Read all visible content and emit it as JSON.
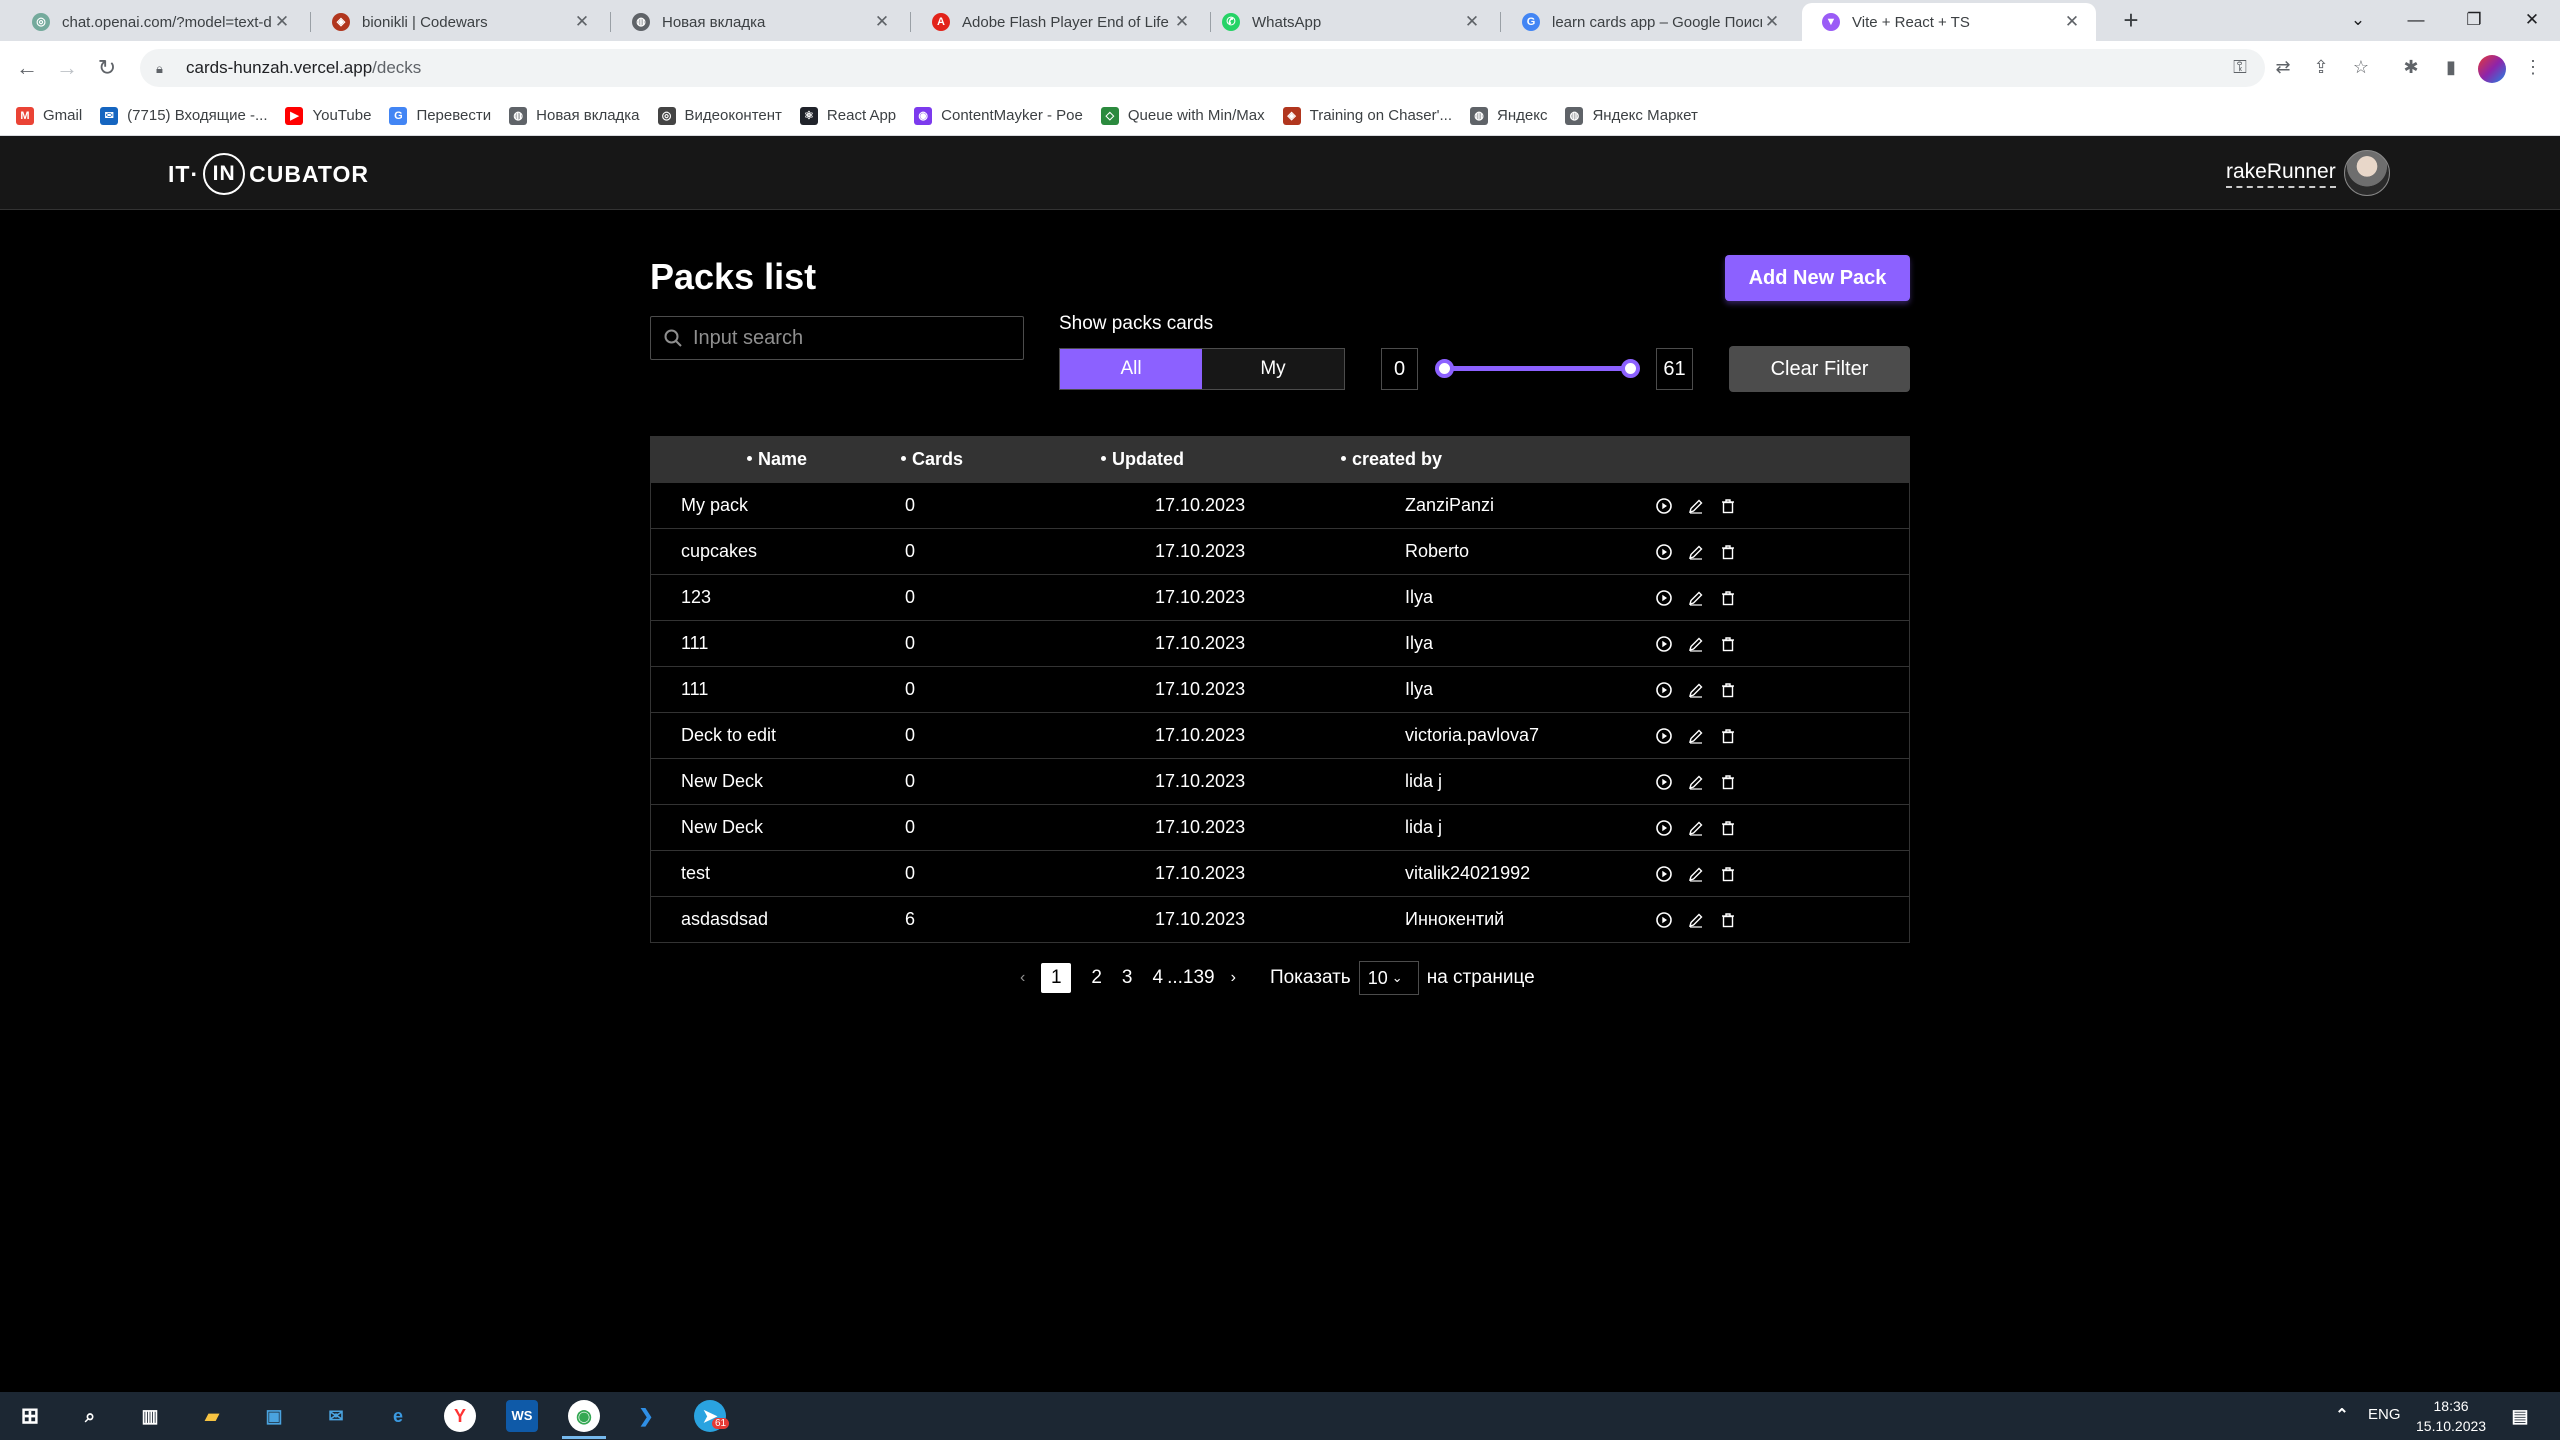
{
  "browser": {
    "tabs": [
      {
        "title": "chat.openai.com/?model=text-d",
        "color": "#74aa9c",
        "glyph": "◎"
      },
      {
        "title": "bionikli | Codewars",
        "color": "#b1361e",
        "glyph": "◈"
      },
      {
        "title": "Новая вкладка",
        "color": "#5f6368",
        "glyph": "◍"
      },
      {
        "title": "Adobe Flash Player End of Life",
        "color": "#e2231a",
        "glyph": "A"
      },
      {
        "title": "WhatsApp",
        "color": "#25d366",
        "glyph": "✆"
      },
      {
        "title": "learn cards app – Google Поиск",
        "color": "#4285f4",
        "glyph": "G"
      },
      {
        "title": "Vite + React + TS",
        "color": "#9a5cf6",
        "glyph": "▼"
      }
    ],
    "url_host": "cards-hunzah.vercel.app",
    "url_path": "/decks",
    "bookmarks": [
      {
        "label": "Gmail",
        "color": "#ea4335",
        "glyph": "M"
      },
      {
        "label": "(7715) Входящие -...",
        "color": "#1565c0",
        "glyph": "✉"
      },
      {
        "label": "YouTube",
        "color": "#ff0000",
        "glyph": "▶"
      },
      {
        "label": "Перевести",
        "color": "#4285f4",
        "glyph": "G"
      },
      {
        "label": "Новая вкладка",
        "color": "#5f6368",
        "glyph": "◍"
      },
      {
        "label": "Видеоконтент",
        "color": "#444",
        "glyph": "◎"
      },
      {
        "label": "React App",
        "color": "#20232a",
        "glyph": "⚛"
      },
      {
        "label": "ContentMayker - Poe",
        "color": "#7c3aed",
        "glyph": "◉"
      },
      {
        "label": "Queue with Min/Max",
        "color": "#2b8a3e",
        "glyph": "◇"
      },
      {
        "label": "Training on Chaser'...",
        "color": "#b1361e",
        "glyph": "◈"
      },
      {
        "label": "Яндекс",
        "color": "#5f6368",
        "glyph": "◍"
      },
      {
        "label": "Яндекс Маркет",
        "color": "#5f6368",
        "glyph": "◍"
      }
    ]
  },
  "header": {
    "logo_left": "IT·",
    "logo_mid": "IN",
    "logo_right": "CUBATOR",
    "username": "rakeRunner"
  },
  "main": {
    "title": "Packs list",
    "add_button": "Add New Pack",
    "search_placeholder": "Input search",
    "show_label": "Show packs cards",
    "segments": [
      {
        "label": "All",
        "active": true
      },
      {
        "label": "My",
        "active": false
      }
    ],
    "range_min": "0",
    "range_max": "61",
    "range_value": [
      0,
      61
    ],
    "clear_button": "Clear Filter"
  },
  "table": {
    "columns": [
      "Name",
      "Cards",
      "Updated",
      "created by"
    ],
    "rows": [
      {
        "name": "My pack",
        "cards": "0",
        "updated": "17.10.2023",
        "by": "ZanziPanzi"
      },
      {
        "name": "cupcakes",
        "cards": "0",
        "updated": "17.10.2023",
        "by": "Roberto"
      },
      {
        "name": "123",
        "cards": "0",
        "updated": "17.10.2023",
        "by": "Ilya"
      },
      {
        "name": "111",
        "cards": "0",
        "updated": "17.10.2023",
        "by": "Ilya"
      },
      {
        "name": "111",
        "cards": "0",
        "updated": "17.10.2023",
        "by": "Ilya"
      },
      {
        "name": "Deck to edit",
        "cards": "0",
        "updated": "17.10.2023",
        "by": "victoria.pavlova7"
      },
      {
        "name": "New Deck",
        "cards": "0",
        "updated": "17.10.2023",
        "by": "lida j"
      },
      {
        "name": "New Deck",
        "cards": "0",
        "updated": "17.10.2023",
        "by": "lida j"
      },
      {
        "name": "test",
        "cards": "0",
        "updated": "17.10.2023",
        "by": "vitalik24021992"
      },
      {
        "name": "asdasdsad",
        "cards": "6",
        "updated": "17.10.2023",
        "by": "Иннокентий"
      }
    ]
  },
  "pagination": {
    "pages": [
      "1",
      "2",
      "3",
      "4"
    ],
    "ellipsis_last": "...139",
    "show_label": "Показать",
    "per_page": "10",
    "per_page_suffix": "на странице"
  },
  "taskbar": {
    "lang": "ENG",
    "time": "18:36",
    "date": "15.10.2023",
    "telegram_badge": "61"
  },
  "colors": {
    "accent": "#8c61ff",
    "bg": "#000000",
    "header": "#171717",
    "table_head": "#333333"
  }
}
